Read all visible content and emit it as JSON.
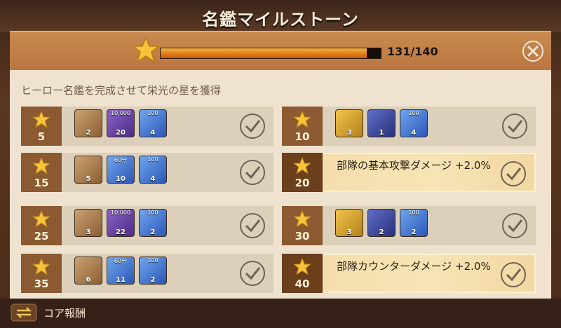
{
  "title": "名鑑マイルストーン",
  "progress": {
    "current": 131,
    "max": 140,
    "text": "131/140"
  },
  "subtitle": "ヒーロー名鑑を完成させて栄光の星を獲得",
  "footer": {
    "label": "コア報酬"
  },
  "left_rows": [
    {
      "tier": "5",
      "items": [
        {
          "kind": "star-medal",
          "color": "bronze",
          "count": "2",
          "top": ""
        },
        {
          "kind": "exp-book",
          "color": "purple",
          "count": "20",
          "top": "10,000"
        },
        {
          "kind": "diamond",
          "color": "blue",
          "count": "4",
          "top": "100"
        }
      ]
    },
    {
      "tier": "15",
      "items": [
        {
          "kind": "binoculars",
          "color": "bronze",
          "count": "5",
          "top": ""
        },
        {
          "kind": "speedup",
          "color": "blue",
          "count": "10",
          "top": "60分"
        },
        {
          "kind": "diamond",
          "color": "blue",
          "count": "4",
          "top": "100"
        }
      ]
    },
    {
      "tier": "25",
      "items": [
        {
          "kind": "star-medal",
          "color": "bronze",
          "count": "3",
          "top": ""
        },
        {
          "kind": "exp-book",
          "color": "purple",
          "count": "22",
          "top": "10,000"
        },
        {
          "kind": "diamond",
          "color": "blue",
          "count": "2",
          "top": "100"
        }
      ]
    },
    {
      "tier": "35",
      "items": [
        {
          "kind": "binoculars",
          "color": "bronze",
          "count": "6",
          "top": ""
        },
        {
          "kind": "speedup",
          "color": "blue",
          "count": "11",
          "top": "60分"
        },
        {
          "kind": "diamond",
          "color": "blue",
          "count": "2",
          "top": "100"
        }
      ]
    }
  ],
  "right_rows": [
    {
      "tier": "10",
      "special": false,
      "items": [
        {
          "kind": "puzzle",
          "color": "gold",
          "count": "3",
          "top": ""
        },
        {
          "kind": "ticket",
          "color": "darkblue",
          "count": "1",
          "top": ""
        },
        {
          "kind": "diamond",
          "color": "blue",
          "count": "4",
          "top": "100"
        }
      ]
    },
    {
      "tier": "20",
      "special": true,
      "text": "部隊の基本攻撃ダメージ +2.0%"
    },
    {
      "tier": "30",
      "special": false,
      "items": [
        {
          "kind": "puzzle",
          "color": "gold",
          "count": "3",
          "top": ""
        },
        {
          "kind": "ticket",
          "color": "darkblue",
          "count": "2",
          "top": ""
        },
        {
          "kind": "diamond",
          "color": "blue",
          "count": "2",
          "top": "100"
        }
      ]
    },
    {
      "tier": "40",
      "special": true,
      "text": "部隊カウンターダメージ +2.0%"
    }
  ],
  "icons": {
    "close": "close-x-icon",
    "check": "check-circle-icon",
    "star": "star-icon",
    "swap": "swap-arrows-icon"
  }
}
